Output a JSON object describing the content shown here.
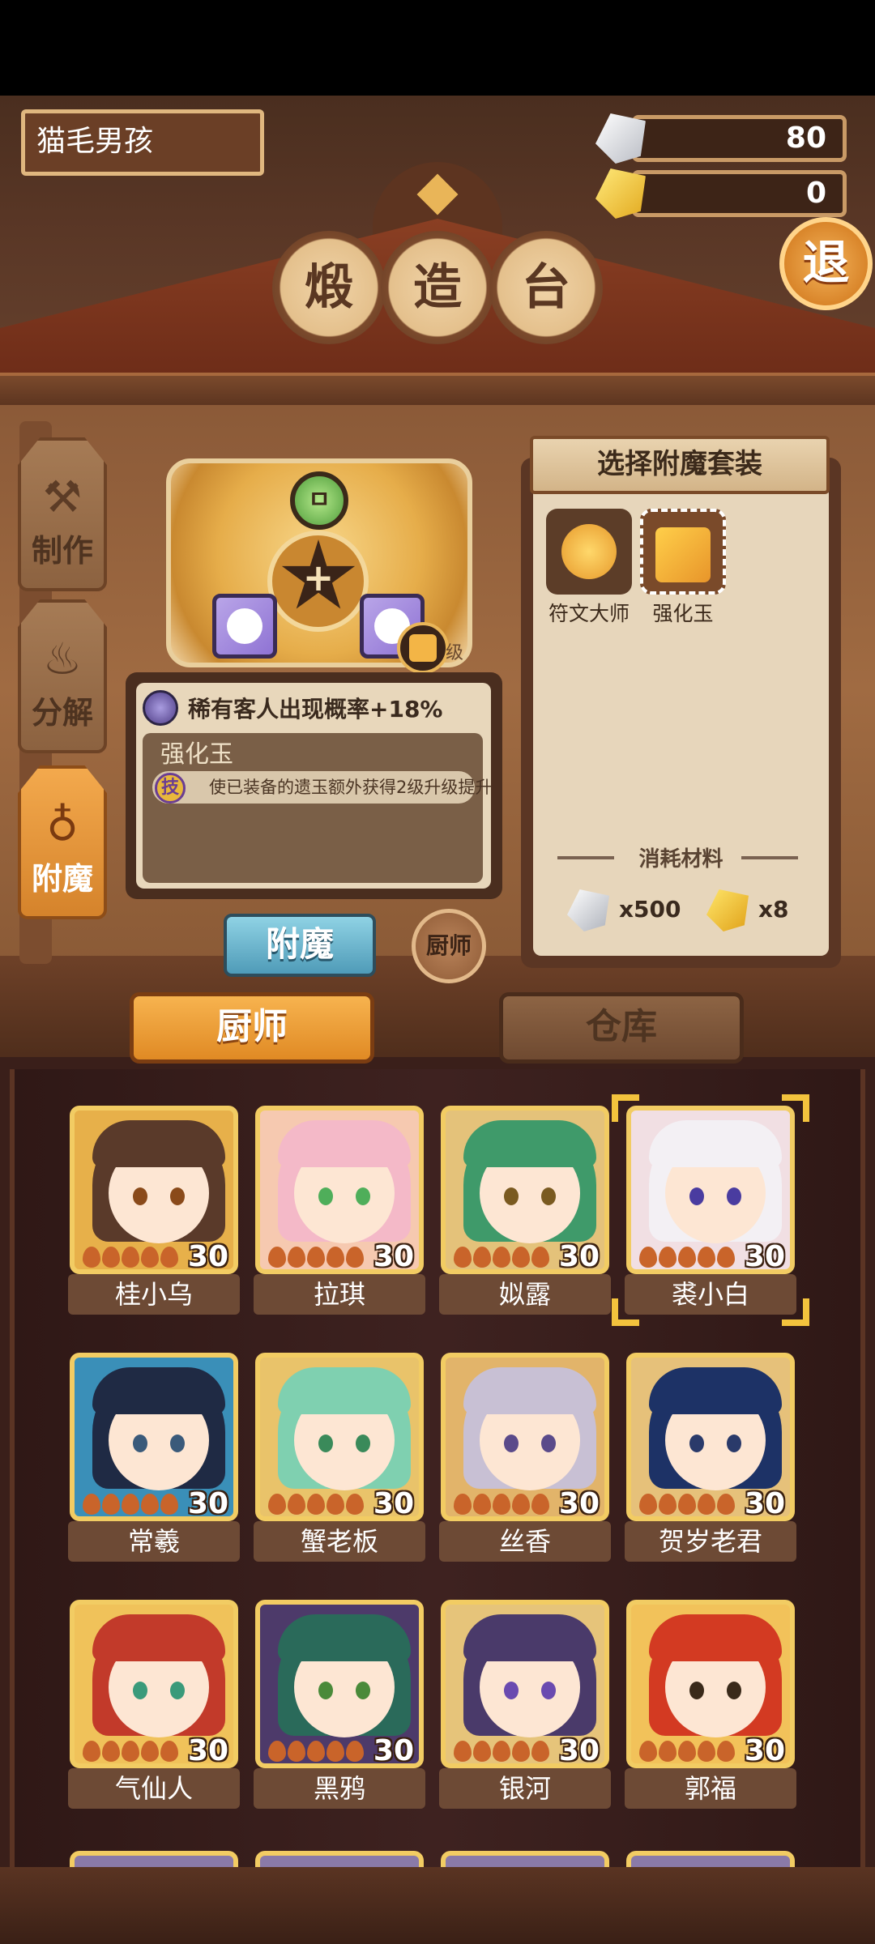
{
  "header": {
    "player_name": "猫毛男孩",
    "silver_count": "80",
    "gold_count": "0",
    "exit_label": "退",
    "title_chars": [
      "煅",
      "造",
      "台"
    ]
  },
  "side_tabs": [
    {
      "label": "制作",
      "icon": "hammer-icon"
    },
    {
      "label": "分解",
      "icon": "flame-icon"
    },
    {
      "label": "附魔",
      "icon": "swirl-icon",
      "active": true
    }
  ],
  "forge": {
    "level_text": "级",
    "center_glyph": "+",
    "top_gem_glyph": "ㅁ"
  },
  "description": {
    "title": "稀有客人出现概率+18%",
    "subtitle": "强化玉",
    "skill_badge": "技",
    "skill_text": "使已装备的遗玉额外获得2级升级提升"
  },
  "actions": {
    "enchant_label": "附魔",
    "chef_button_label": "厨师"
  },
  "enchant_set": {
    "header": "选择附魔套装",
    "items": [
      {
        "label": "符文大师",
        "icon": "rune-master-icon"
      },
      {
        "label": "强化玉",
        "icon": "enhance-jade-icon",
        "selected": true
      }
    ],
    "cost_title": "消耗材料",
    "costs": [
      {
        "icon": "silver-ore-icon",
        "qty": "x500"
      },
      {
        "icon": "gold-ore-icon",
        "qty": "x8"
      }
    ]
  },
  "list_tabs": {
    "chef": "厨师",
    "warehouse": "仓库"
  },
  "chefs": [
    {
      "name": "桂小乌",
      "level": "30",
      "hair": "#5a3a2a",
      "bg": "#e7b04a",
      "eye": "#8a4a1a"
    },
    {
      "name": "拉琪",
      "level": "30",
      "hair": "#f4b9c8",
      "bg": "#f6c9b0",
      "eye": "#4fae5a"
    },
    {
      "name": "姒露",
      "level": "30",
      "hair": "#3f9a6a",
      "bg": "#e4c27a",
      "eye": "#7a5a20"
    },
    {
      "name": "裘小白",
      "level": "30",
      "hair": "#f3f0f4",
      "bg": "#f1dfe3",
      "eye": "#4a3ca0",
      "selected": true
    },
    {
      "name": "常羲",
      "level": "30",
      "hair": "#1f2a44",
      "bg": "#3a8fb8",
      "eye": "#3a5a7a"
    },
    {
      "name": "蟹老板",
      "level": "30",
      "hair": "#7fd0b0",
      "bg": "#e9c36a",
      "eye": "#3a8a5a"
    },
    {
      "name": "丝香",
      "level": "30",
      "hair": "#c8c0d4",
      "bg": "#e2b46a",
      "eye": "#5a4a8a"
    },
    {
      "name": "贺岁老君",
      "level": "30",
      "hair": "#1d3266",
      "bg": "#e6c17a",
      "eye": "#2a3a6a"
    },
    {
      "name": "气仙人",
      "level": "30",
      "hair": "#c23a2a",
      "bg": "#f0c25a",
      "eye": "#3a9a7a"
    },
    {
      "name": "黑鸦",
      "level": "30",
      "hair": "#2a6a5a",
      "bg": "#4d3a6a",
      "eye": "#4a8a3a"
    },
    {
      "name": "银河",
      "level": "30",
      "hair": "#4a3a6a",
      "bg": "#e6c47a",
      "eye": "#6a4ab0"
    },
    {
      "name": "郭福",
      "level": "30",
      "hair": "#d33a22",
      "bg": "#f2c25a",
      "eye": "#3a2a1a"
    }
  ]
}
